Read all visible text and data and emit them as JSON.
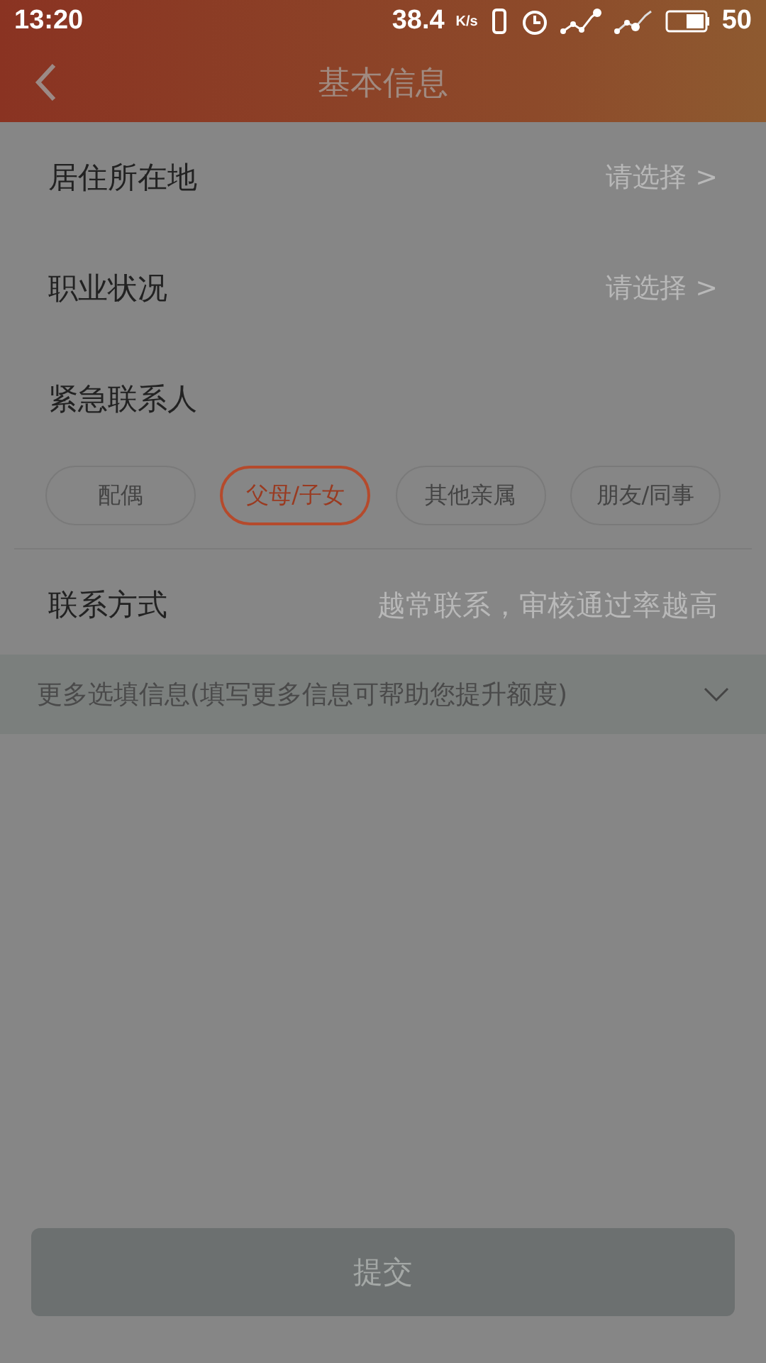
{
  "status_bar": {
    "time": "13:20",
    "speed": "38.4",
    "speed_unit": "K/s",
    "battery": "50"
  },
  "header": {
    "title": "基本信息"
  },
  "rows": [
    {
      "kind": "select",
      "label": "居住所在地",
      "placeholder": "请选择 >"
    },
    {
      "kind": "select",
      "label": "职业状况",
      "placeholder": "请选择 >"
    },
    {
      "kind": "heading",
      "label": "紧急联系人"
    }
  ],
  "relations": [
    {
      "label": "配偶",
      "selected": false
    },
    {
      "label": "父母/子女",
      "selected": true
    },
    {
      "label": "其他亲属",
      "selected": false
    },
    {
      "label": "朋友/同事",
      "selected": false
    }
  ],
  "contact": {
    "label": "联系方式",
    "placeholder": "越常联系，审核通过率越高"
  },
  "more_info": {
    "label": "更多选填信息(填写更多信息可帮助您提升额度)",
    "expanded": false
  },
  "submit": {
    "label": "提交",
    "disabled": true
  }
}
